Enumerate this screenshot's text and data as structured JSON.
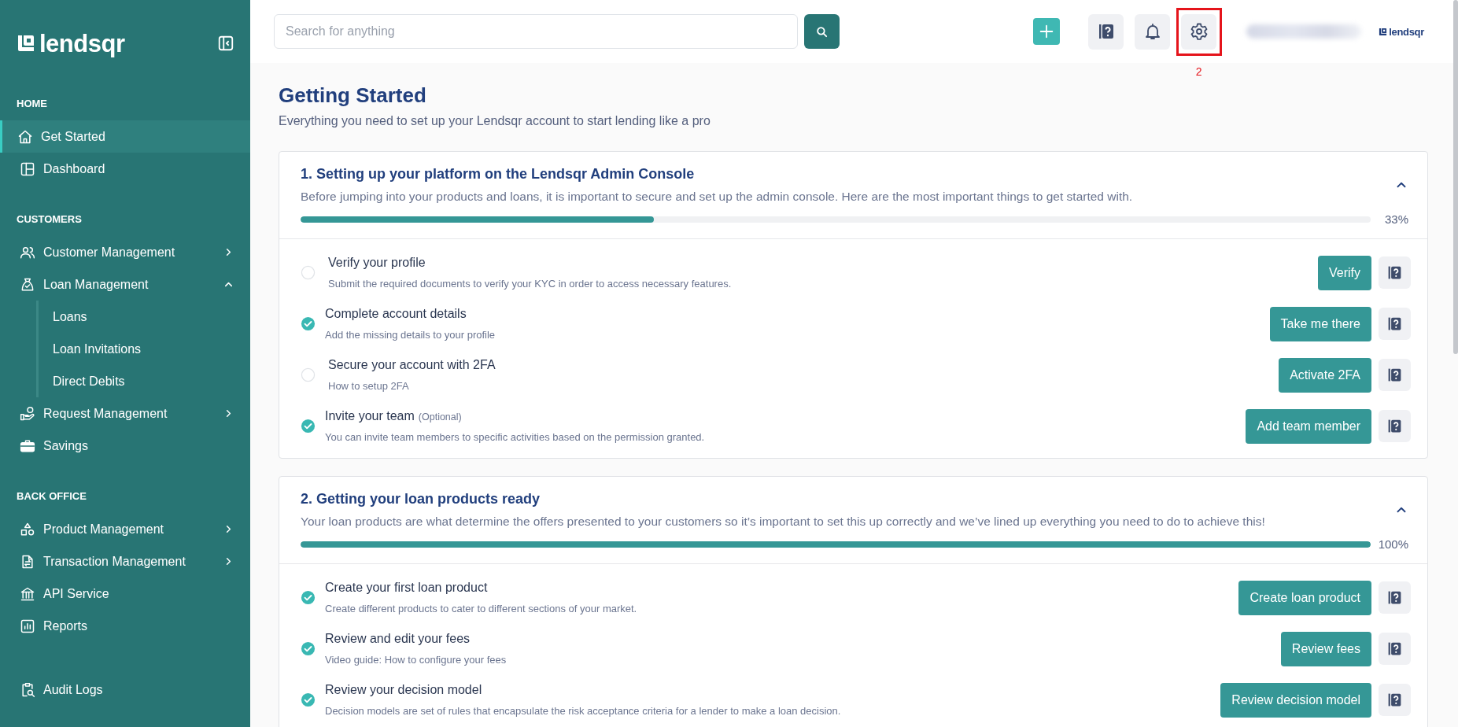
{
  "sidebar": {
    "logo": "lendsqr",
    "sections": [
      {
        "title": "HOME",
        "items": [
          {
            "label": "Get Started",
            "selected": true
          },
          {
            "label": "Dashboard",
            "selected": false
          }
        ]
      },
      {
        "title": "CUSTOMERS",
        "items": [
          {
            "label": "Customer Management",
            "selected": false,
            "expanded": false
          },
          {
            "label": "Loan Management",
            "selected": false,
            "expanded": true,
            "children": [
              {
                "label": "Loans",
                "selected": false
              },
              {
                "label": "Loan Invitations",
                "selected": false
              },
              {
                "label": "Direct Debits",
                "selected": false
              }
            ]
          },
          {
            "label": "Request Management",
            "selected": false,
            "expanded": false
          },
          {
            "label": "Savings",
            "selected": false
          }
        ]
      },
      {
        "title": "BACK OFFICE",
        "items": [
          {
            "label": "Product Management",
            "selected": false,
            "expanded": false
          },
          {
            "label": "Transaction Management",
            "selected": false,
            "expanded": false
          },
          {
            "label": "API Service",
            "selected": false
          },
          {
            "label": "Reports",
            "selected": false
          }
        ]
      },
      {
        "items": [
          {
            "label": "Audit Logs",
            "selected": false
          }
        ]
      }
    ]
  },
  "topbar": {
    "search": {
      "placeholder": "Search for anything"
    },
    "annotation": {
      "label": "2"
    },
    "logo": "lendsqr"
  },
  "page": {
    "title": "Getting Started",
    "subtitle": "Everything you need to set up your Lendsqr account to start lending like a pro"
  },
  "steps": [
    {
      "title": "1. Setting up your platform on the Lendsqr Admin Console",
      "description": "Before jumping into your products and loans, it is important to secure and set up the admin console. Here are the most important things to get started with.",
      "expanded": true,
      "level": 0.33,
      "reading": "33%",
      "tasks": [
        {
          "title": "Verify your profile",
          "description": "Submit the required documents to verify your KYC in order to access necessary features.",
          "done": false,
          "button": "Verify"
        },
        {
          "title": "Complete account details",
          "description": "Add the missing details to your profile",
          "done": true,
          "button": "Take me there"
        },
        {
          "title": "Secure your account with 2FA",
          "description": "How to setup 2FA",
          "done": false,
          "button": "Activate 2FA"
        },
        {
          "title": "Invite your team",
          "note": "(Optional)",
          "description": "You can invite team members to specific activities based on the permission granted.",
          "done": true,
          "button": "Add team member"
        }
      ]
    },
    {
      "title": "2. Getting your loan products ready",
      "description": "Your loan products are what determine the offers presented to your customers so it’s important to set this up correctly and we’ve lined up everything you need to do to achieve this!",
      "expanded": true,
      "level": 1,
      "reading": "100%",
      "tasks": [
        {
          "title": "Create your first loan product",
          "description": "Create different products to cater to different sections of your market.",
          "done": true,
          "button": "Create loan product"
        },
        {
          "title": "Review and edit your fees",
          "description": "Video guide: How to configure your fees",
          "done": true,
          "button": "Review fees"
        },
        {
          "title": "Review your decision model",
          "description": "Decision models are set of rules that encapsulate the risk acceptance criteria for a lender to make a loan decision.",
          "done": true,
          "button": "Review decision model"
        }
      ]
    }
  ]
}
